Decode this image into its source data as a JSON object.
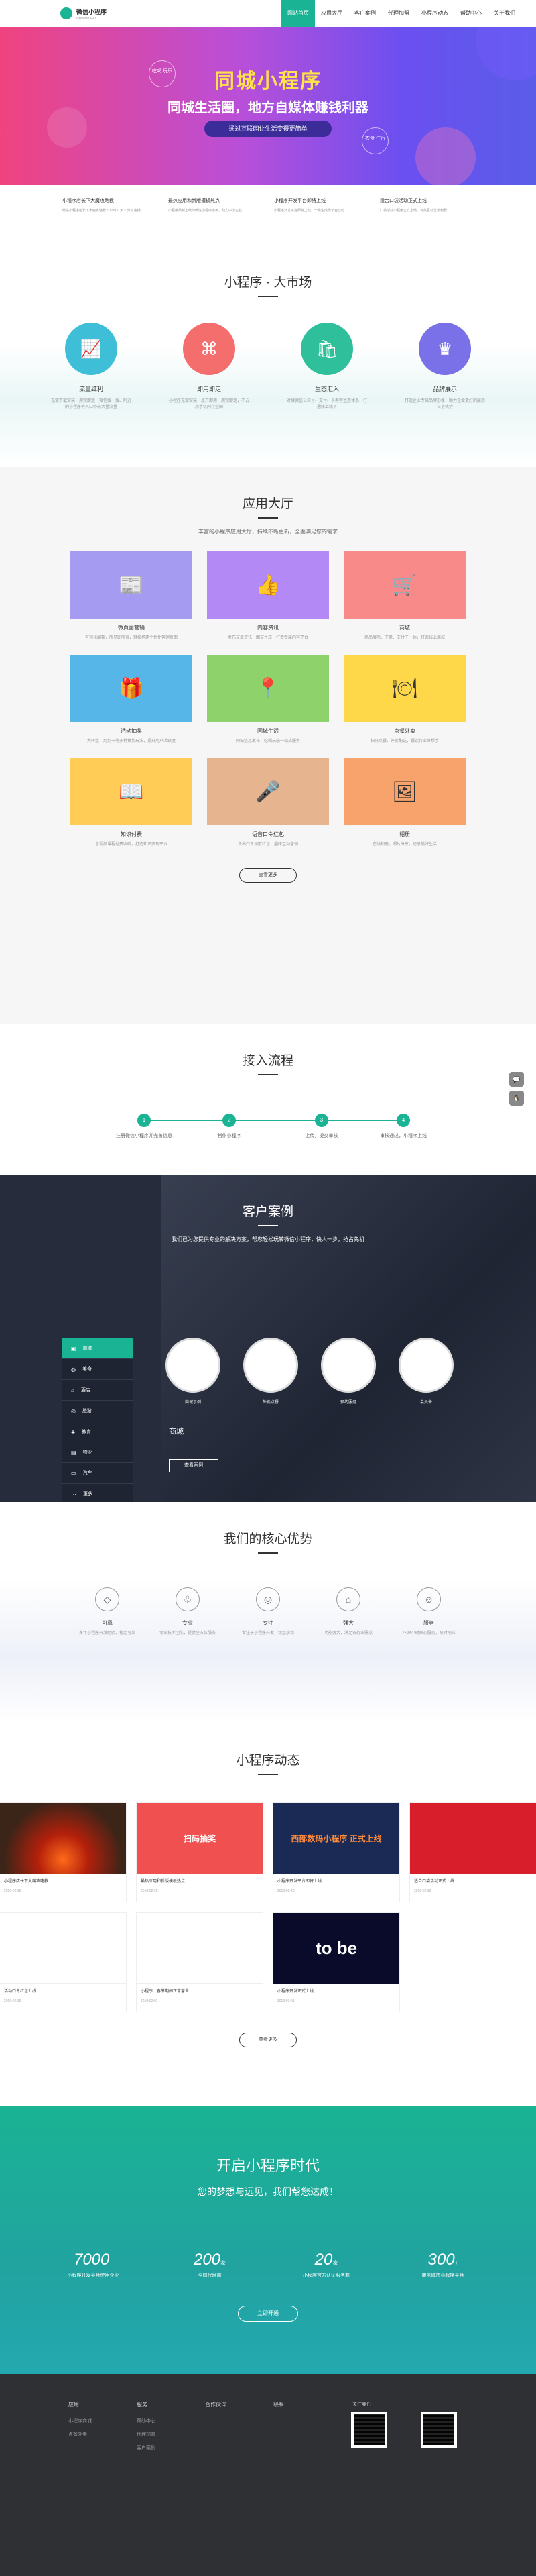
{
  "header": {
    "logo_text": "微信小程序",
    "logo_sub": "www.xxx.com",
    "nav": [
      "网站首页",
      "应用大厅",
      "客户案例",
      "代理加盟",
      "小程序动态",
      "帮助中心",
      "关于我们"
    ]
  },
  "hero": {
    "title": "同城小程序",
    "subtitle": "同城生活圈，地方自媒体赚钱利器",
    "button": "通过互联网让生活变得更简单",
    "badge_left": "吃喝\n玩乐",
    "badge_right": "衣食\n住行"
  },
  "news_strip": [
    {
      "title": "小程序店长下大魔攻略教",
      "desc": "微信小程序店长下大魔攻略教 1 小时 0 天 1 分享店铺"
    },
    {
      "title": "最热应用和新版模板热点",
      "desc": "小程序最新上线的微信小程序模板，助力中小企业"
    },
    {
      "title": "小程序开发平台即将上线",
      "desc": "小程序开发平台即将上线，一键生成属于自己的"
    },
    {
      "title": "适合口袋活动正式上线",
      "desc": "口袋活动小程序正式上线，有奖互动营销利器"
    }
  ],
  "market": {
    "title": "小程序 · 大市场",
    "items": [
      {
        "title": "流量红利",
        "desc": "无需下载安装，用完即走，微信搜一搜、附近的小程序等入口带来大量流量",
        "color": "#3ebfd7",
        "icon": "chart"
      },
      {
        "title": "即用即走",
        "desc": "小程序无需安装，点开即用，用完即走，不占用手机内存空间",
        "color": "#f46e6e",
        "icon": "command"
      },
      {
        "title": "生态汇入",
        "desc": "对接微信公众号、支付、卡券等生态体系，打通线上线下",
        "color": "#2fbf9b",
        "icon": "bag"
      },
      {
        "title": "品牌展示",
        "desc": "打造企业专属品牌形象，助力企业更好的展示自身优势",
        "color": "#7a70e8",
        "icon": "crown"
      }
    ]
  },
  "hall": {
    "title": "应用大厅",
    "subtitle": "丰富的小程序应用大厅，持续不断更新，全面满足您的需求",
    "apps": [
      {
        "title": "微页面营销",
        "desc": "可视化编辑，所见即所得，轻松搭建个性化营销页面",
        "bg": "#a59bf0",
        "icon": "📰"
      },
      {
        "title": "内容资讯",
        "desc": "发布文章资讯，图文并茂，打造专属内容平台",
        "bg": "#b38af5",
        "icon": "👍"
      },
      {
        "title": "商城",
        "desc": "商品展示、下单、支付于一体，打造线上商城",
        "bg": "#f98a8a",
        "icon": "🛒"
      },
      {
        "title": "活动抽奖",
        "desc": "大转盘、刮刮卡等多种抽奖玩法，提升用户活跃度",
        "bg": "#56b6e8",
        "icon": "🎁"
      },
      {
        "title": "同城生活",
        "desc": "同城信息发布，吃喝玩乐一站式服务",
        "bg": "#8dd26a",
        "icon": "📍"
      },
      {
        "title": "点餐外卖",
        "desc": "扫码点餐、外卖配送，餐饮行业好帮手",
        "bg": "#ffd84a",
        "icon": "🍽"
      },
      {
        "title": "知识付费",
        "desc": "音视频课程付费收听，打造知识变现平台",
        "bg": "#ffcc55",
        "icon": "📖"
      },
      {
        "title": "语音口令红包",
        "desc": "说出口令领取红包，趣味互动营销",
        "bg": "#e6b58f",
        "icon": "🎤"
      },
      {
        "title": "相册",
        "desc": "在线相册，照片分享，记录美好生活",
        "bg": "#f8a36b",
        "icon": "🖼"
      }
    ],
    "more": "查看更多"
  },
  "flow": {
    "title": "接入流程",
    "steps": [
      {
        "n": "1",
        "label": "注册微信小程序并完善信息"
      },
      {
        "n": "2",
        "label": "制作小程序"
      },
      {
        "n": "3",
        "label": "上传并提交审核"
      },
      {
        "n": "4",
        "label": "审核通过，小程序上线"
      }
    ]
  },
  "cases": {
    "title": "客户案例",
    "subtitle": "我们已为您提供专业的解决方案，帮您轻松玩转微信小程序，快人一步，抢占先机",
    "menu": [
      "商城",
      "美食",
      "酒店",
      "旅游",
      "教育",
      "物业",
      "汽车",
      "更多"
    ],
    "circles": [
      "商城示例",
      "外卖点餐",
      "预约服务",
      "会员卡"
    ],
    "active_name": "商城",
    "button": "查看案例"
  },
  "adv": {
    "title": "我们的核心优势",
    "items": [
      {
        "title": "可靠",
        "desc": "多年小程序开发经验，稳定可靠",
        "icon": "◇"
      },
      {
        "title": "专业",
        "desc": "专业技术团队，提供全方位服务",
        "icon": "♧"
      },
      {
        "title": "专注",
        "desc": "专注于小程序开发，精益求精",
        "icon": "◎"
      },
      {
        "title": "强大",
        "desc": "功能强大，满足各行业需求",
        "icon": "⌂"
      },
      {
        "title": "服务",
        "desc": "7×24小时贴心服务，及时响应",
        "icon": "☺"
      }
    ]
  },
  "dyn": {
    "title": "小程序动态",
    "posts": [
      {
        "title": "小程序店长下大魔攻略教",
        "date": "2018-02-28",
        "bg": "#3b2418",
        "label": ""
      },
      {
        "title": "最热应用和新版模板热点",
        "date": "2018-02-28",
        "bg": "#f05050",
        "label": "扫码抽奖"
      },
      {
        "title": "小程序开发平台即将上线",
        "date": "2018-02-28",
        "bg": "#1a2a55",
        "label": "西部数码小程序 正式上线"
      },
      {
        "title": "适合口袋活动正式上线",
        "date": "2018-02-28",
        "bg": "#d81e2a",
        "label": ""
      },
      {
        "title": "活动口令红包上线",
        "date": "2018-02-28",
        "bg": "#ffffff",
        "label": ""
      },
      {
        "title": "小程序：春节期间正常营业",
        "date": "2018-03-01",
        "bg": "#ffffff",
        "label": ""
      },
      {
        "title": "小程序开发正式上线",
        "date": "2018-03-01",
        "bg": "#0a0a2a",
        "label": "to be"
      }
    ],
    "more": "查看更多"
  },
  "era": {
    "title": "开启小程序时代",
    "subtitle": "您的梦想与远见，我们帮您达成！",
    "stats": [
      {
        "n": "7000",
        "unit": "+",
        "label": "小程序开发平台使用企业"
      },
      {
        "n": "200",
        "unit": "家",
        "label": "全国代理商"
      },
      {
        "n": "20",
        "unit": "家",
        "label": "小程序官方认证服务商"
      },
      {
        "n": "300",
        "unit": "+",
        "label": "覆盖城市小程序平台"
      }
    ],
    "button": "立即开通"
  },
  "footer": {
    "cols": [
      {
        "h": "应用",
        "items": [
          "小程序商城",
          "点餐外卖"
        ]
      },
      {
        "h": "服务",
        "items": [
          "帮助中心",
          "代理加盟",
          "客户案例"
        ]
      },
      {
        "h": "合作伙伴",
        "items": [
          "",
          "",
          ""
        ]
      },
      {
        "h": "联系",
        "items": [
          "",
          "",
          ""
        ]
      }
    ],
    "qr_label": "关注我们",
    "copyright": ""
  }
}
